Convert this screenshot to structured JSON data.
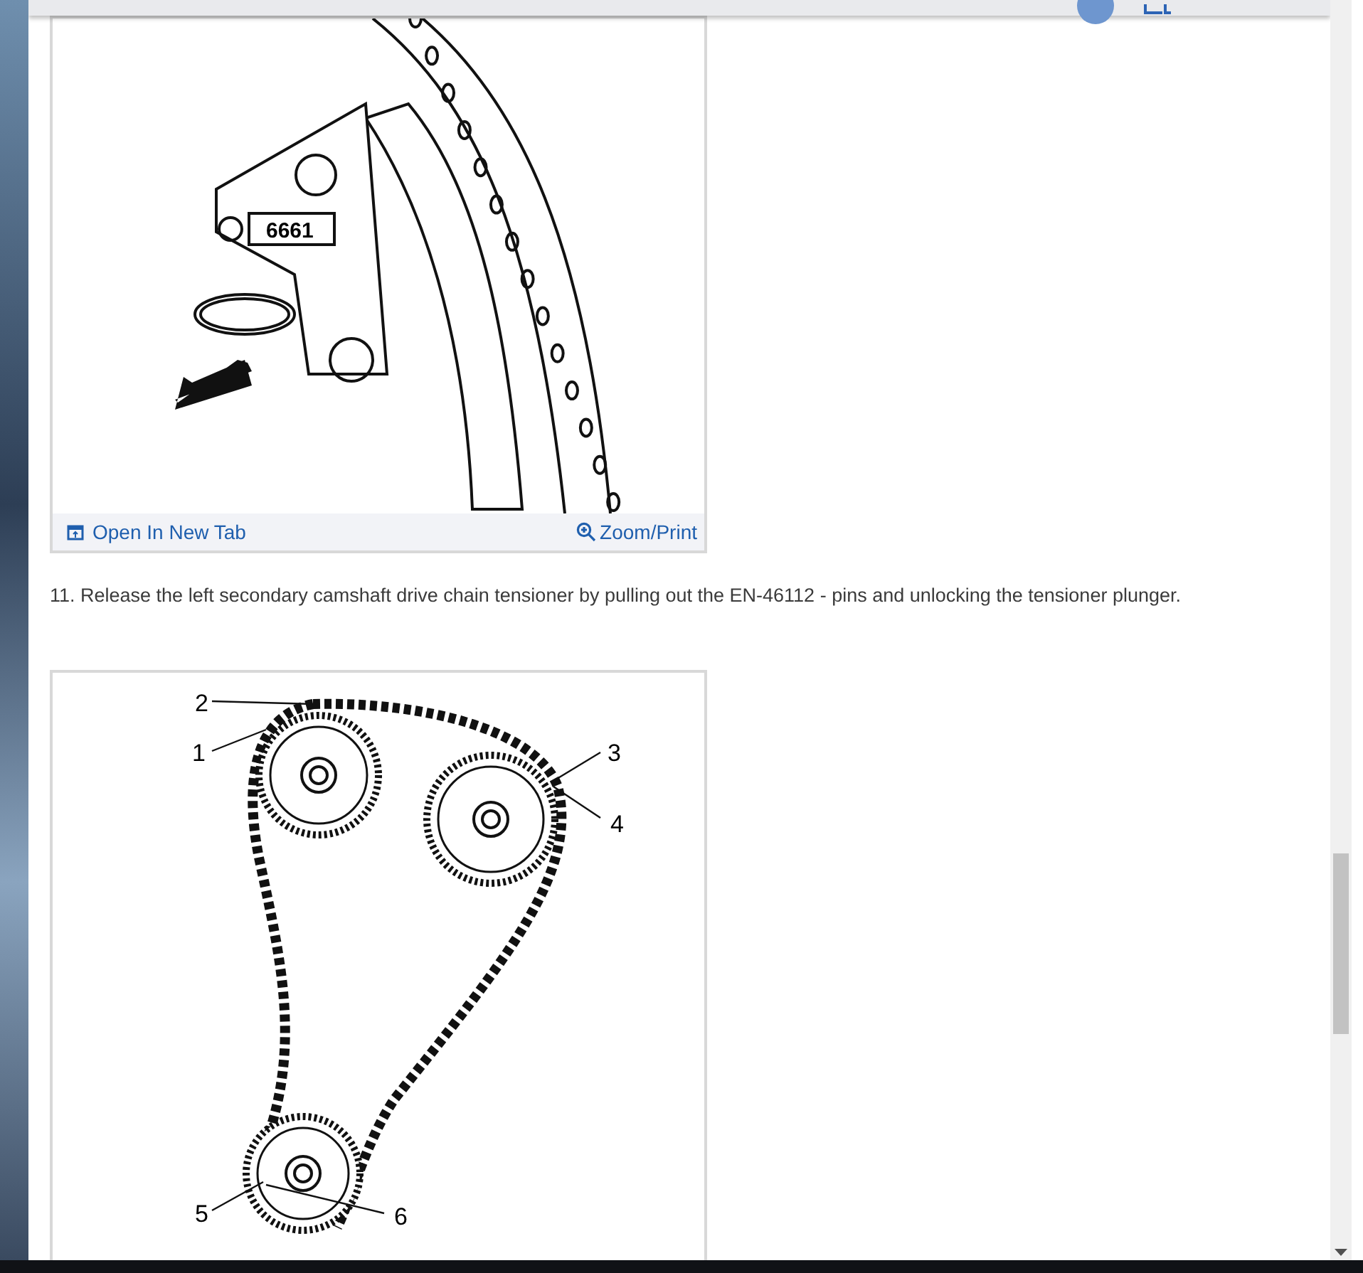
{
  "figures": [
    {
      "kind": "tensioner",
      "callouts": [
        "6661"
      ],
      "footer": {
        "open_link": "Open In New Tab",
        "zoom_link": "Zoom/Print"
      }
    },
    {
      "kind": "chain",
      "callouts": [
        "2",
        "1",
        "3",
        "4",
        "5",
        "6"
      ]
    }
  ],
  "step": "11. Release the left secondary camshaft drive chain tensioner by pulling out the EN-46112 - pins and unlocking the tensioner plunger."
}
